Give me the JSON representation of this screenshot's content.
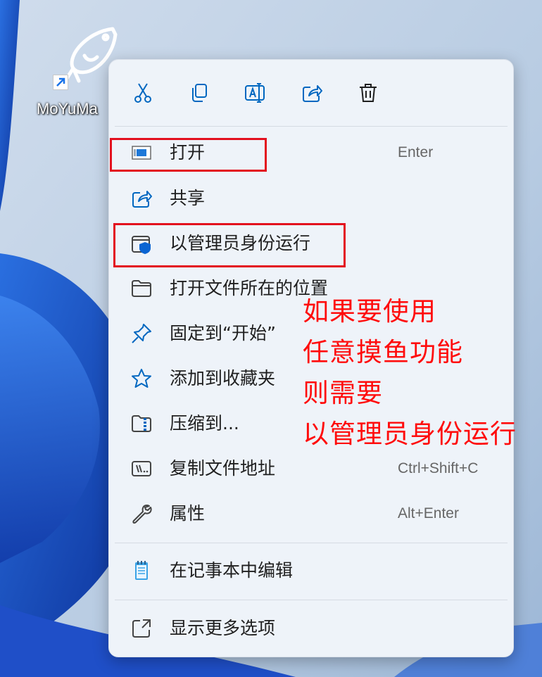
{
  "desktop": {
    "shortcut": {
      "label": "MoYuMa",
      "icon": "fish-icon"
    }
  },
  "context_menu": {
    "toolbar": [
      {
        "name": "cut-button",
        "icon": "scissors-icon"
      },
      {
        "name": "copy-button",
        "icon": "copy-icon"
      },
      {
        "name": "rename-button",
        "icon": "rename-icon"
      },
      {
        "name": "share-button",
        "icon": "share-icon"
      },
      {
        "name": "delete-button",
        "icon": "trash-icon"
      }
    ],
    "items": [
      {
        "label": "打开",
        "shortcut": "Enter",
        "icon": "app-window-icon"
      },
      {
        "label": "共享",
        "shortcut": "",
        "icon": "share-icon"
      },
      {
        "label": "以管理员身份运行",
        "shortcut": "",
        "icon": "admin-shield-icon"
      },
      {
        "label": "打开文件所在的位置",
        "shortcut": "",
        "icon": "folder-icon"
      },
      {
        "label": "固定到“开始”",
        "shortcut": "",
        "icon": "pin-icon"
      },
      {
        "label": "添加到收藏夹",
        "shortcut": "",
        "icon": "star-icon"
      },
      {
        "label": "压缩到...",
        "shortcut": "",
        "icon": "zip-folder-icon"
      },
      {
        "label": "复制文件地址",
        "shortcut": "Ctrl+Shift+C",
        "icon": "copy-path-icon"
      },
      {
        "label": "属性",
        "shortcut": "Alt+Enter",
        "icon": "wrench-icon"
      },
      {
        "label": "在记事本中编辑",
        "shortcut": "",
        "icon": "notepad-icon"
      },
      {
        "label": "显示更多选项",
        "shortcut": "",
        "icon": "more-options-icon"
      }
    ]
  },
  "annotation": {
    "lines": [
      "如果要使用",
      "任意摸鱼功能",
      "则需要",
      "以管理员身份运行"
    ],
    "color": "#ff0c0c"
  },
  "colors": {
    "menu_bg": "#eef3f9",
    "icon_accent": "#0067c0",
    "highlight": "#e3101e"
  }
}
